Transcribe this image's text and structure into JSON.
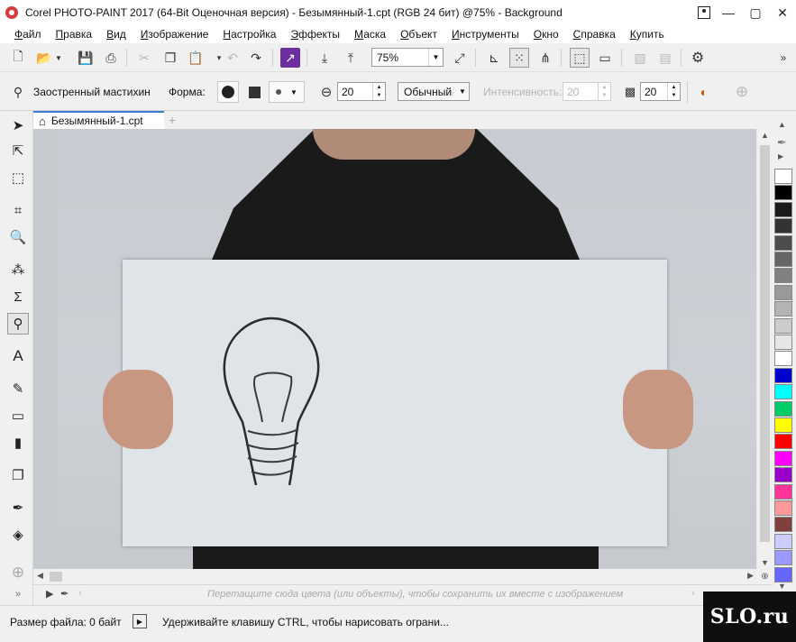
{
  "window": {
    "title": "Corel PHOTO-PAINT 2017 (64-Bit Оценочная версия) - Безымянный-1.cpt (RGB 24 бит) @75% - Background",
    "minimize": "—",
    "restore": "▢",
    "close": "✕"
  },
  "menu": {
    "items": [
      "Файл",
      "Правка",
      "Вид",
      "Изображение",
      "Настройка",
      "Эффекты",
      "Маска",
      "Объект",
      "Инструменты",
      "Окно",
      "Справка",
      "Купить"
    ]
  },
  "toolbar": {
    "zoom": "75%",
    "more": "»"
  },
  "property_bar": {
    "tool_name": "Заостренный мастихин",
    "shape_label": "Форма:",
    "size": "20",
    "blend_mode": "Обычный",
    "intensity_label": "Интенсивность:",
    "intensity": "20",
    "transparency": "20"
  },
  "document": {
    "tab_name": "Безымянный-1.cpt",
    "add_tab": "+"
  },
  "color_tray": {
    "hint": "Перетащите сюда цвета (или объекты), чтобы сохранить их вместе с изображением"
  },
  "status": {
    "file_size": "Размер файла: 0 байт",
    "message": "Удерживайте клавишу CTRL, чтобы нарисовать ограни..."
  },
  "watermark": "SLO.ru",
  "palette": {
    "colors": [
      "#ffffff",
      "#000000",
      "#1a1a1a",
      "#333333",
      "#4d4d4d",
      "#666666",
      "#808080",
      "#999999",
      "#b3b3b3",
      "#cccccc",
      "#e6e6e6",
      "#ffffff",
      "#0000cc",
      "#00ffff",
      "#00cc66",
      "#ffff00",
      "#ff0000",
      "#ff00ff",
      "#9900cc",
      "#ff3399",
      "#ff9999",
      "#804040",
      "#ccccff",
      "#9999ff",
      "#6666ff"
    ]
  }
}
